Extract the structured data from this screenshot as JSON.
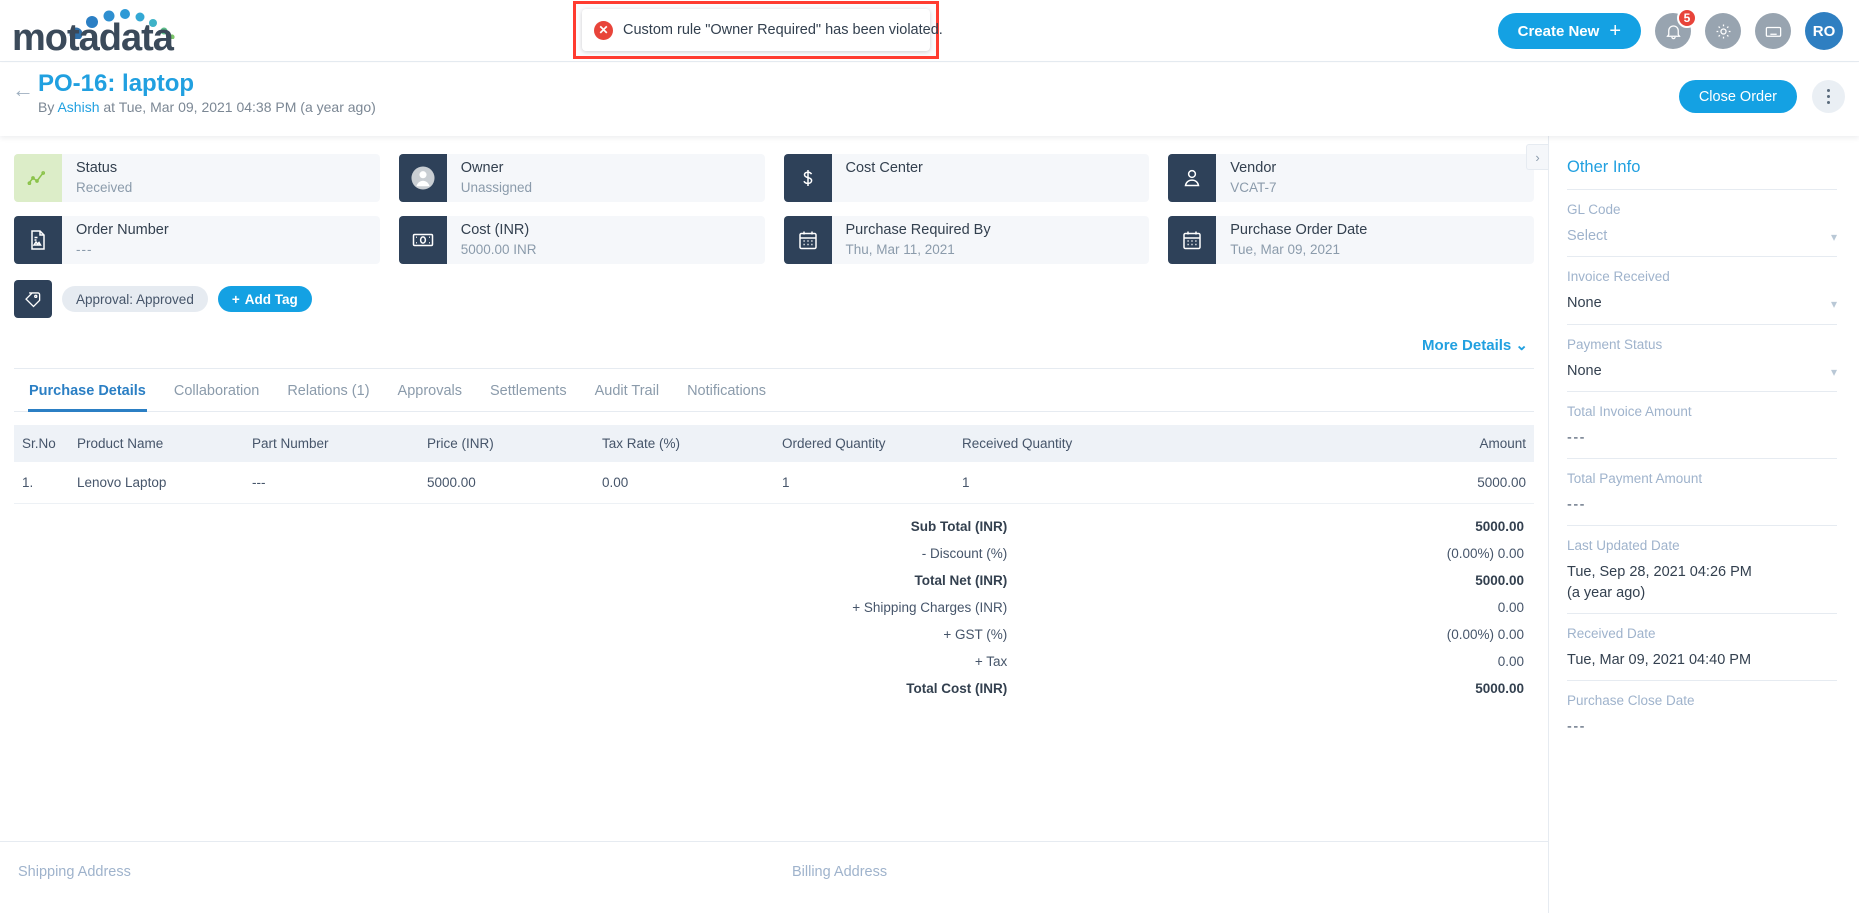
{
  "brand": {
    "name": "motadata"
  },
  "banner": {
    "icon": "error-circle-icon",
    "message": "Custom rule \"Owner Required\" has been violated."
  },
  "topbar": {
    "create_new_label": "Create New",
    "create_new_plus": "+",
    "notifications_badge": "5",
    "notification_icon": "bell-icon",
    "settings_icon": "gear-icon",
    "keyboard_icon": "keyboard-icon",
    "avatar_initials": "RO"
  },
  "title_bar": {
    "back_icon": "back-arrow-icon",
    "title": "PO-16: laptop",
    "sub_prefix": "By ",
    "sub_user": "Ashish",
    "sub_rest": " at Tue, Mar 09, 2021 04:38 PM (a year ago)",
    "close_order_label": "Close Order",
    "kebab_icon": "more-vertical-icon"
  },
  "cards": [
    {
      "icon": "chart-line-icon",
      "label": "Status",
      "value": "Received",
      "style": "green"
    },
    {
      "icon": "user-avatar-icon",
      "label": "Owner",
      "value": "Unassigned",
      "style": "avatar"
    },
    {
      "icon": "dollar-icon",
      "label": "Cost Center",
      "value": "",
      "style": "dark"
    },
    {
      "icon": "vendor-user-icon",
      "label": "Vendor",
      "value": "VCAT-7",
      "style": "dark"
    },
    {
      "icon": "document-icon",
      "label": "Order Number",
      "value": "---",
      "style": "dark"
    },
    {
      "icon": "money-note-icon",
      "label": "Cost (INR)",
      "value": "5000.00 INR",
      "style": "dark"
    },
    {
      "icon": "calendar-icon",
      "label": "Purchase Required By",
      "value": "Thu, Mar 11, 2021",
      "style": "dark"
    },
    {
      "icon": "calendar-icon",
      "label": "Purchase Order Date",
      "value": "Tue, Mar 09, 2021",
      "style": "dark"
    }
  ],
  "tags": {
    "icon": "tag-icon",
    "chips": [
      "Approval: Approved"
    ],
    "add_tag_label": "Add Tag",
    "add_tag_plus": "+"
  },
  "more_details": {
    "label": "More Details",
    "chevron": "⌄"
  },
  "tabs": [
    {
      "label": "Purchase Details",
      "active": true
    },
    {
      "label": "Collaboration",
      "active": false
    },
    {
      "label": "Relations (1)",
      "active": false
    },
    {
      "label": "Approvals",
      "active": false
    },
    {
      "label": "Settlements",
      "active": false
    },
    {
      "label": "Audit Trail",
      "active": false
    },
    {
      "label": "Notifications",
      "active": false
    }
  ],
  "table": {
    "columns": [
      "Sr.No",
      "Product Name",
      "Part Number",
      "Price (INR)",
      "Tax Rate (%)",
      "Ordered Quantity",
      "Received Quantity",
      "Amount"
    ],
    "rows": [
      {
        "sr": "1.",
        "product": "Lenovo Laptop",
        "part": "---",
        "price": "5000.00",
        "tax_rate": "0.00",
        "ordered_qty": "1",
        "received_qty": "1",
        "amount": "5000.00"
      }
    ]
  },
  "totals": [
    {
      "label": "Sub Total (INR)",
      "value": "5000.00",
      "bold": true
    },
    {
      "label": "- Discount (%)",
      "value": "(0.00%) 0.00",
      "bold": false
    },
    {
      "label": "Total Net (INR)",
      "value": "5000.00",
      "bold": true
    },
    {
      "label": "+ Shipping Charges (INR)",
      "value": "0.00",
      "bold": false
    },
    {
      "label": "+ GST (%)",
      "value": "(0.00%) 0.00",
      "bold": false
    },
    {
      "label": "+ Tax",
      "value": "0.00",
      "bold": false
    },
    {
      "label": "Total Cost (INR)",
      "value": "5000.00",
      "bold": true
    }
  ],
  "addresses": {
    "shipping_title": "Shipping Address",
    "billing_title": "Billing Address"
  },
  "collapse_handle": {
    "icon": "chevron-right-icon",
    "glyph": "›"
  },
  "right_panel": {
    "title": "Other Info",
    "fields": [
      {
        "label": "GL Code",
        "value": "Select",
        "muted": true,
        "chevron": true
      },
      {
        "label": "Invoice Received",
        "value": "None",
        "muted": false,
        "chevron": true
      },
      {
        "label": "Payment Status",
        "value": "None",
        "muted": false,
        "chevron": true
      },
      {
        "label": "Total Invoice Amount",
        "value": "---",
        "muted": false,
        "chevron": false
      },
      {
        "label": "Total Payment Amount",
        "value": "---",
        "muted": false,
        "chevron": false
      },
      {
        "label": "Last Updated Date",
        "value": "Tue, Sep 28, 2021 04:26 PM\n(a year ago)",
        "muted": false,
        "chevron": false
      },
      {
        "label": "Received Date",
        "value": "Tue, Mar 09, 2021 04:40 PM",
        "muted": false,
        "chevron": false
      },
      {
        "label": "Purchase Close Date",
        "value": "---",
        "muted": false,
        "chevron": false
      }
    ]
  },
  "colors": {
    "accent_blue": "#14a1e3",
    "link_blue": "#21a0e0",
    "dark_navy": "#2e4159",
    "error_red": "#e8443a",
    "status_green": "#8bc34a",
    "panel_bg": "#f5f7fa"
  }
}
